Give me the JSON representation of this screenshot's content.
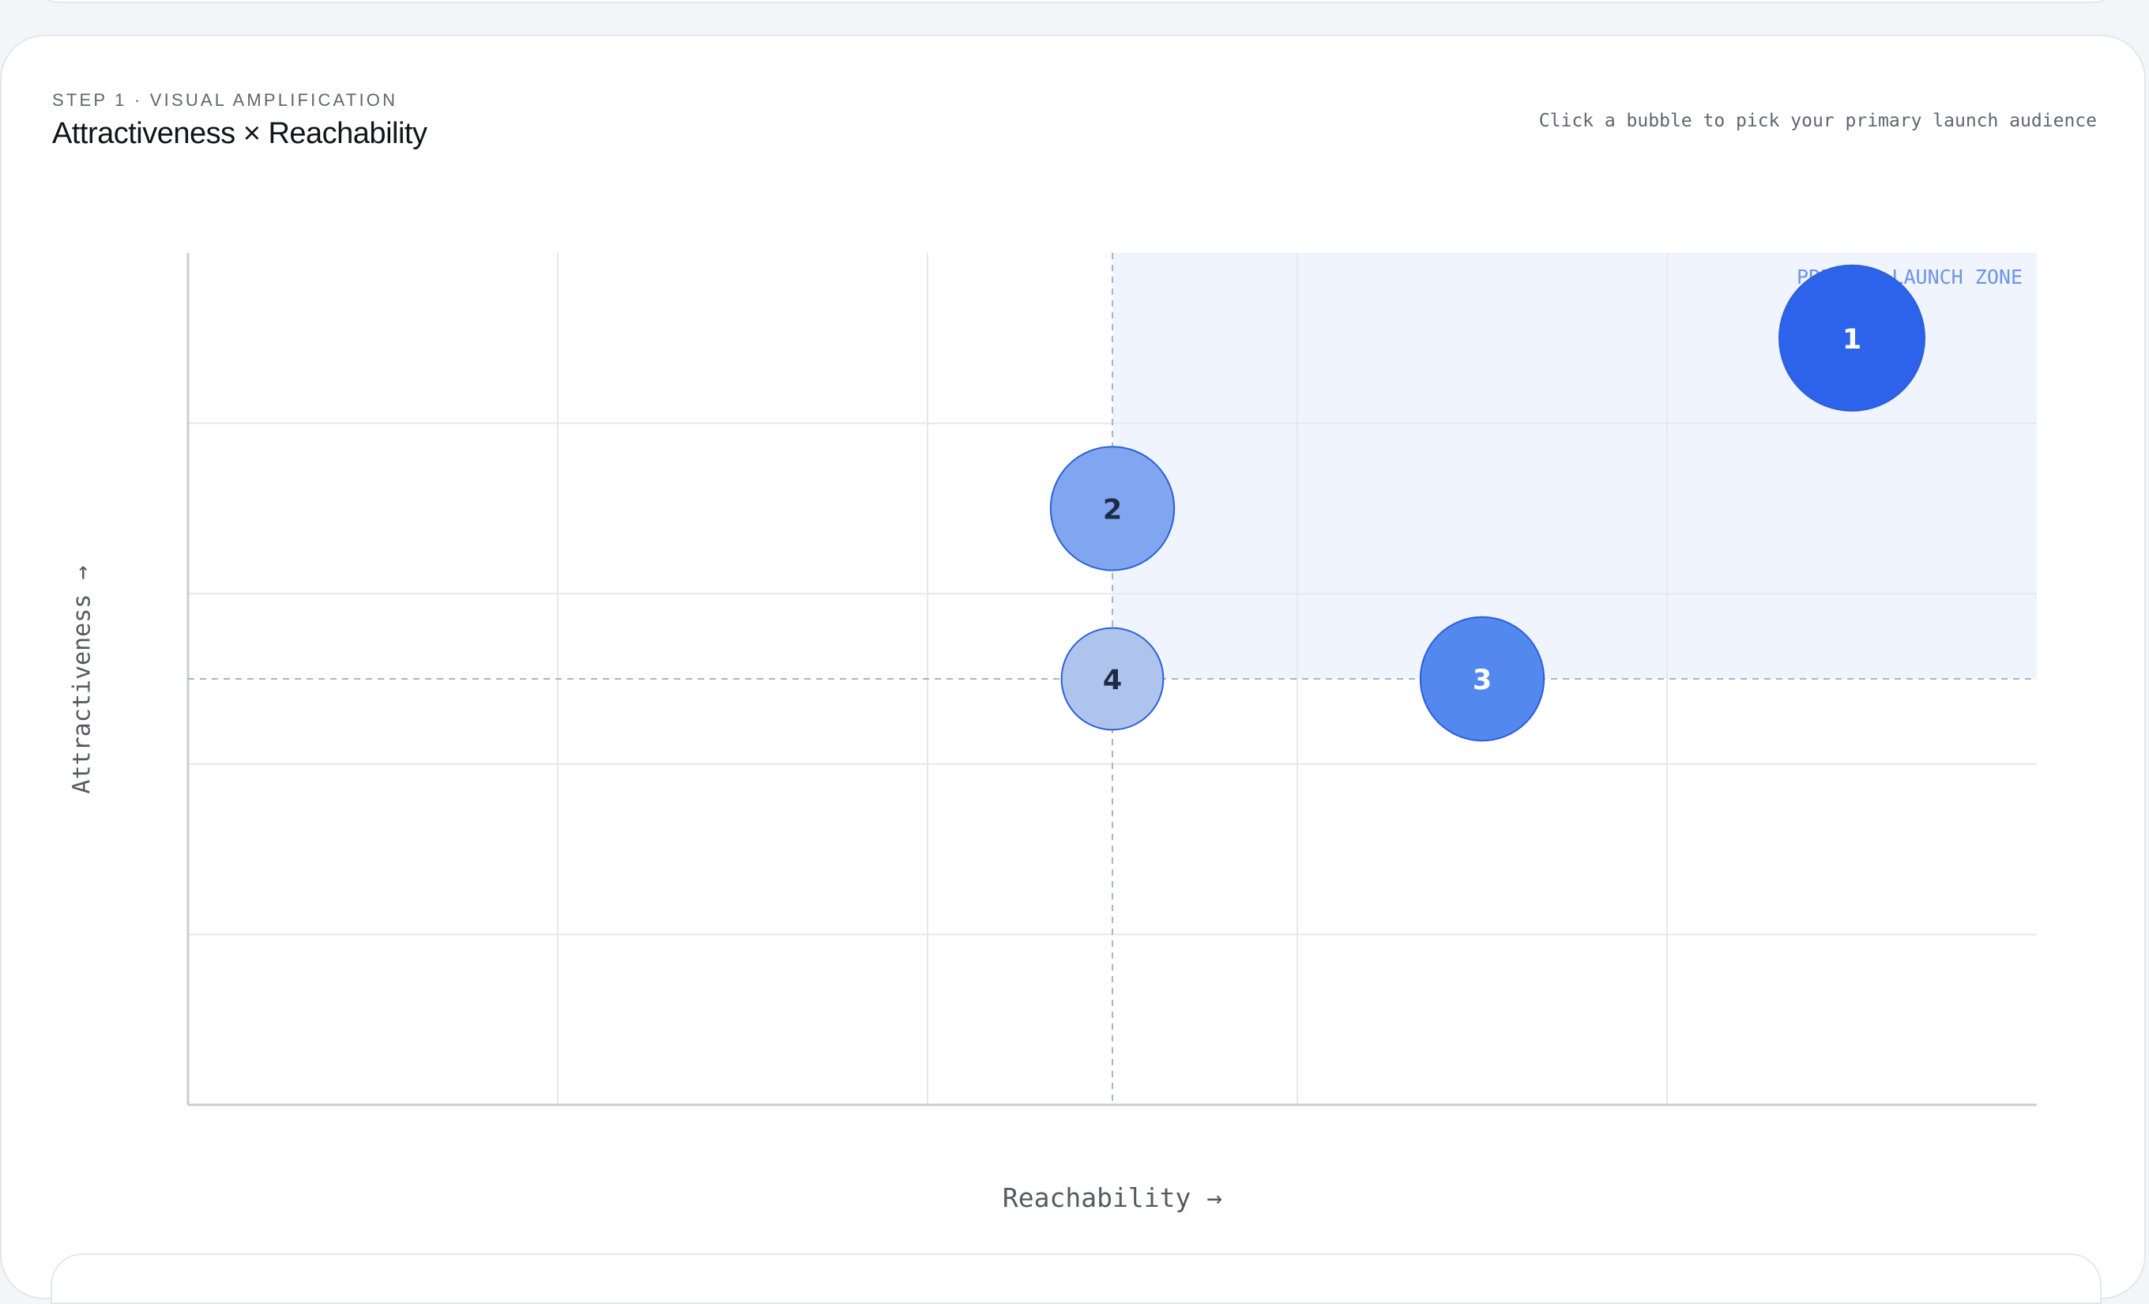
{
  "header": {
    "eyebrow": "STEP 1 · VISUAL AMPLIFICATION",
    "title": "Attractiveness × Reachability",
    "hint": "Click a bubble to pick your primary launch audience"
  },
  "chart_data": {
    "type": "scatter",
    "title": "Attractiveness × Reachability",
    "xlabel": "Reachability →",
    "ylabel": "Attractiveness →",
    "xlim": [
      0,
      5
    ],
    "ylim": [
      0,
      5
    ],
    "grid": true,
    "thresholds": {
      "x": 2.5,
      "y": 2.5
    },
    "zone": {
      "label": "PRIMARY LAUNCH ZONE",
      "x": [
        2.5,
        5
      ],
      "y": [
        2.5,
        5
      ]
    },
    "points": [
      {
        "label": "1",
        "x": 4.5,
        "y": 4.5,
        "size": 1.0,
        "color": "#2c63ea",
        "text_color": "#ffffff"
      },
      {
        "label": "2",
        "x": 2.5,
        "y": 3.5,
        "size": 0.85,
        "color": "#80a6ef",
        "text_color": "#1f2a44"
      },
      {
        "label": "3",
        "x": 3.5,
        "y": 2.5,
        "size": 0.85,
        "color": "#5388ee",
        "text_color": "#ffffff"
      },
      {
        "label": "4",
        "x": 2.5,
        "y": 2.5,
        "size": 0.7,
        "color": "#aec4ec",
        "text_color": "#1f2a44"
      }
    ],
    "colors": {
      "zone_fill": "#eff4fe",
      "zone_text": "#6f93e6",
      "grid": "#e6e8eb",
      "axis": "#c9cdd2",
      "threshold": "#a9b4c9"
    }
  }
}
